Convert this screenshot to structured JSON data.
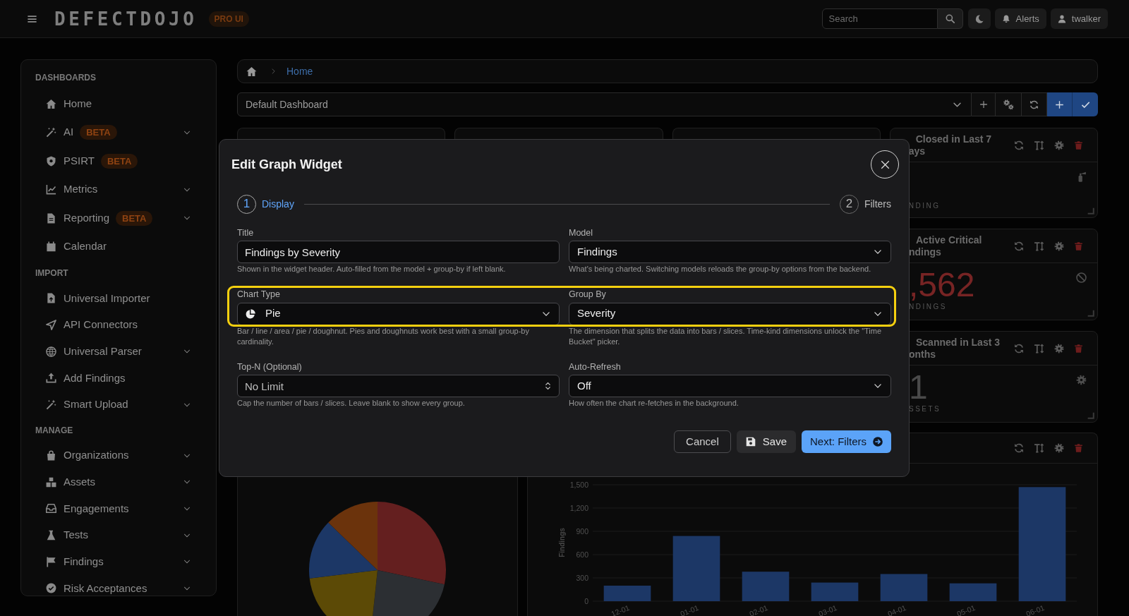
{
  "top_bar": {
    "logo": "DEFECTDOJO",
    "badge": "PRO UI",
    "search": {
      "placeholder": "Search"
    },
    "buttons": [
      {
        "label": "Alerts"
      },
      {
        "label": "twalker"
      }
    ]
  },
  "sidebar": {
    "sections": [
      {
        "title": "DASHBOARDS",
        "items": [
          {
            "label": "Home",
            "submenu": false
          },
          {
            "label": "AI",
            "badge": "BETA",
            "submenu": true
          },
          {
            "label": "PSIRT",
            "badge": "BETA",
            "submenu": false
          },
          {
            "label": "Metrics",
            "submenu": true
          },
          {
            "label": "Reporting",
            "badge": "BETA",
            "submenu": true
          },
          {
            "label": "Calendar",
            "submenu": false
          }
        ]
      },
      {
        "title": "IMPORT",
        "items": [
          {
            "label": "Universal Importer",
            "submenu": false
          },
          {
            "label": "API Connectors",
            "submenu": false
          },
          {
            "label": "Universal Parser",
            "submenu": true
          },
          {
            "label": "Add Findings",
            "submenu": false
          },
          {
            "label": "Smart Upload",
            "submenu": true
          }
        ]
      },
      {
        "title": "MANAGE",
        "items": [
          {
            "label": "Organizations",
            "submenu": true
          },
          {
            "label": "Assets",
            "submenu": true
          },
          {
            "label": "Engagements",
            "submenu": true
          },
          {
            "label": "Tests",
            "submenu": true
          },
          {
            "label": "Findings",
            "submenu": true
          },
          {
            "label": "Risk Acceptances",
            "submenu": true
          }
        ]
      }
    ]
  },
  "breadcrumb": [
    "Home"
  ],
  "dashboard_picker": {
    "value": "Default Dashboard"
  },
  "widgets": [
    {
      "kind": "stat",
      "title_lines": [
        "Closed in Last 7",
        "ays"
      ],
      "caption": "NDING"
    },
    {
      "kind": "stat",
      "title_lines": [
        "Active Critical",
        "ndings"
      ],
      "value": ",562",
      "color": "#772424",
      "caption": "NDINGS"
    },
    {
      "kind": "stat",
      "title_lines": [
        "Scanned in Last 3",
        "onths"
      ],
      "value": "1",
      "color": "#4a4a4a",
      "caption": "SSETS"
    },
    {
      "kind": "pie"
    },
    {
      "kind": "bar",
      "chart_data": {
        "type": "bar",
        "ylabel": "Findings",
        "categories": [
          "12-01",
          "01-01",
          "02-01",
          "03-01",
          "04-01",
          "05-01",
          "06-01"
        ],
        "values": [
          200,
          840,
          380,
          240,
          350,
          230,
          1470
        ],
        "ylim": [
          0,
          1500
        ],
        "yticks": [
          {
            "value": 0,
            "label": "0"
          },
          {
            "value": 300,
            "label": "300"
          },
          {
            "value": 600,
            "label": "600"
          },
          {
            "value": 900,
            "label": "900"
          },
          {
            "value": 1200,
            "label": "1,200"
          },
          {
            "value": 1500,
            "label": "1,500"
          }
        ],
        "grid": true
      }
    }
  ],
  "dialog": {
    "title": "Edit Graph Widget",
    "steps": [
      {
        "number": "1",
        "label": "Display",
        "selected": true
      },
      {
        "number": "2",
        "label": "Filters",
        "selected": false
      }
    ],
    "rows": [
      {
        "highlighted": false,
        "fields": [
          {
            "label": "Title",
            "kind": "text",
            "value": "Findings by Severity",
            "help": "Shown in the widget header. Auto-filled from the model + group-by if left blank."
          },
          {
            "label": "Model",
            "kind": "select",
            "value": "Findings",
            "help": "What's being charted. Switching models reloads the group-by options from the backend."
          }
        ]
      },
      {
        "highlighted": true,
        "fields": [
          {
            "label": "Chart Type",
            "kind": "chart",
            "value": "Pie",
            "help": "Bar / line / area / pie / doughnut. Pies and doughnuts work best with a small group-by cardinality."
          },
          {
            "label": "Group By",
            "kind": "select",
            "value": "Severity",
            "help": "The dimension that splits the data into bars / slices. Time-kind dimensions unlock the \"Time Bucket\" picker."
          }
        ]
      },
      {
        "highlighted": false,
        "fields": [
          {
            "label": "Top-N (Optional)",
            "kind": "number",
            "placeholder": "No Limit",
            "help": "Cap the number of bars / slices. Leave blank to show every group."
          },
          {
            "label": "Auto-Refresh",
            "kind": "select",
            "value": "Off",
            "help": "How often the chart re-fetches in the background."
          }
        ]
      }
    ],
    "buttons": [
      {
        "label": "Cancel",
        "kind": "outline"
      },
      {
        "label": "Save",
        "kind": "save"
      },
      {
        "label": "Next: Filters",
        "kind": "primary"
      }
    ]
  }
}
